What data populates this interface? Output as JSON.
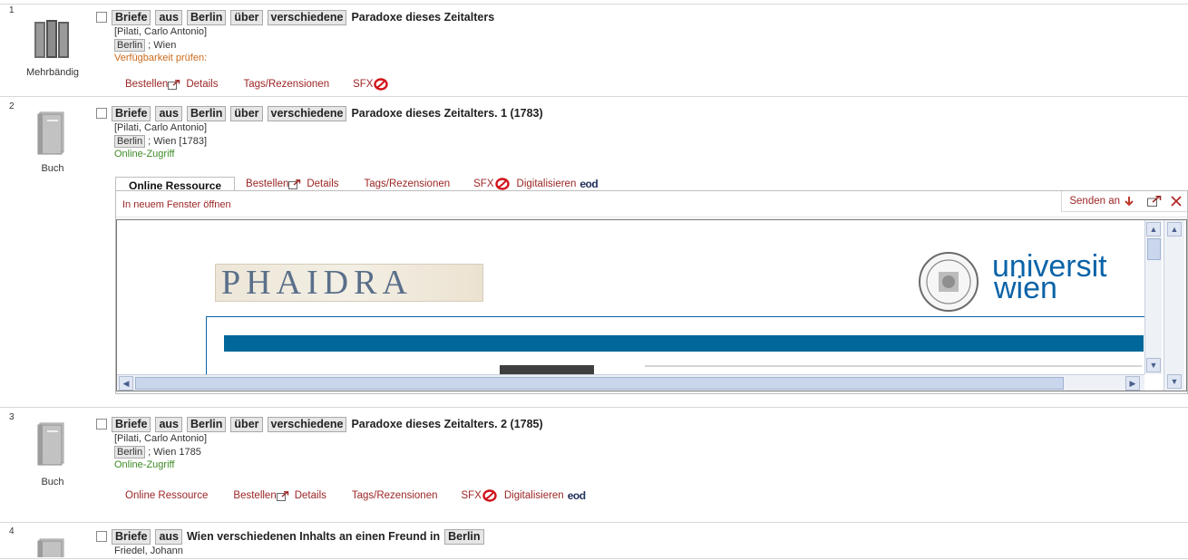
{
  "results": [
    {
      "number": "1",
      "media_type": "Mehrbändig",
      "title_words": [
        "Briefe",
        "aus",
        "Berlin",
        "über",
        "verschiedene"
      ],
      "title_rest": "Paradoxe dieses Zeitalters",
      "author": "[Pilati, Carlo Antonio]",
      "place_link": "Berlin",
      "place_rest": " ; Wien",
      "availability": "Verfügbarkeit prüfen:",
      "links": [
        "Bestellen",
        "Details",
        "Tags/Rezensionen",
        "SFX"
      ]
    },
    {
      "number": "2",
      "media_type": "Buch",
      "title_words": [
        "Briefe",
        "aus",
        "Berlin",
        "über",
        "verschiedene"
      ],
      "title_rest": "Paradoxe dieses Zeitalters. 1 (1783)",
      "author": "[Pilati, Carlo Antonio]",
      "place_link": "Berlin",
      "place_rest": " ; Wien [1783]",
      "availability": "Online-Zugriff",
      "tabs": [
        "Online Ressource",
        "Bestellen",
        "Details",
        "Tags/Rezensionen",
        "SFX",
        "Digitalisieren",
        "eod"
      ],
      "panel": {
        "open_new_window": "In neuem Fenster öffnen",
        "send_to": "Senden an",
        "phaidra_logo": "PHAIDRA",
        "uni_logo_line1": "universit",
        "uni_logo_line2": "wien"
      }
    },
    {
      "number": "3",
      "media_type": "Buch",
      "title_words": [
        "Briefe",
        "aus",
        "Berlin",
        "über",
        "verschiedene"
      ],
      "title_rest": "Paradoxe dieses Zeitalters. 2 (1785)",
      "author": "[Pilati, Carlo Antonio]",
      "place_link": "Berlin",
      "place_rest": " ; Wien 1785",
      "availability": "Online-Zugriff",
      "links": [
        "Online Ressource",
        "Bestellen",
        "Details",
        "Tags/Rezensionen",
        "SFX",
        "Digitalisieren",
        "eod"
      ]
    },
    {
      "number": "4",
      "title_words": [
        "Briefe",
        "aus"
      ],
      "title_mid": "Wien verschiedenen Inhalts an einen Freund in",
      "title_end_word": "Berlin",
      "author": "Friedel, Johann"
    }
  ],
  "colors": {
    "link": "#9c2525",
    "availability_orange": "#cc6a1a",
    "online_green": "#3d8a24",
    "uni_blue": "#0a63a8",
    "bar_teal": "#00679a"
  }
}
